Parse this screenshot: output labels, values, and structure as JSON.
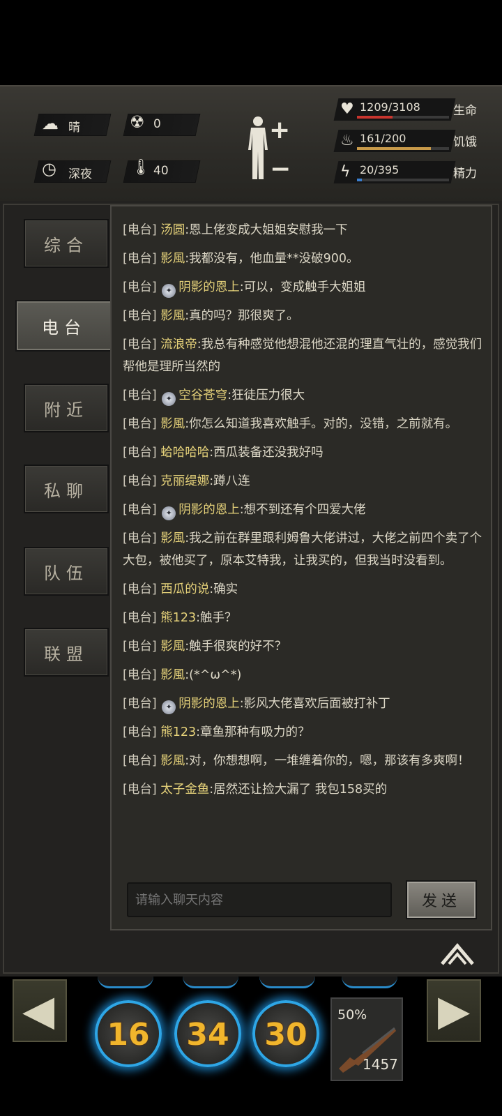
{
  "status": {
    "weather": "晴",
    "radiation": "0",
    "time_of_day": "深夜",
    "temperature": "40",
    "health": {
      "value": "1209/3108",
      "label": "生命",
      "fraction": 0.389,
      "color": "#c8352e"
    },
    "hunger": {
      "value": "161/200",
      "label": "饥饿",
      "fraction": 0.805,
      "color": "#c89a4a"
    },
    "energy": {
      "value": "20/395",
      "label": "精力",
      "fraction": 0.051,
      "color": "#3a7fd0"
    }
  },
  "tabs": [
    {
      "label": "综合"
    },
    {
      "label": "电台",
      "active": true
    },
    {
      "label": "附近"
    },
    {
      "label": "私聊"
    },
    {
      "label": "队伍"
    },
    {
      "label": "联盟"
    }
  ],
  "chat": {
    "messages": [
      {
        "channel": "[电台]",
        "name": "汤圆",
        "text": "恩上佬变成大姐姐安慰我一下",
        "badge": false
      },
      {
        "channel": "[电台]",
        "name": "影風",
        "text": "我都没有，他血量**没破900。",
        "badge": false
      },
      {
        "channel": "[电台]",
        "name": "阴影的恩上",
        "text": "可以，变成触手大姐姐",
        "badge": true
      },
      {
        "channel": "[电台]",
        "name": "影風",
        "text": "真的吗？那很爽了。",
        "badge": false
      },
      {
        "channel": "[电台]",
        "name": "流浪帝",
        "text": "我总有种感觉他想混他还混的理直气壮的，感觉我们帮他是理所当然的",
        "badge": false
      },
      {
        "channel": "[电台]",
        "name": "空谷苍穹",
        "text": "狂徒压力很大",
        "badge": true
      },
      {
        "channel": "[电台]",
        "name": "影風",
        "text": "你怎么知道我喜欢触手。对的，没错，之前就有。",
        "badge": false
      },
      {
        "channel": "[电台]",
        "name": "蛤哈哈哈",
        "text": "西瓜装备还没我好吗",
        "badge": false
      },
      {
        "channel": "[电台]",
        "name": "克丽缇娜",
        "text": "蹲八连",
        "badge": false
      },
      {
        "channel": "[电台]",
        "name": "阴影的恩上",
        "text": "想不到还有个四爱大佬",
        "badge": true
      },
      {
        "channel": "[电台]",
        "name": "影風",
        "text": "我之前在群里跟利姆鲁大佬讲过，大佬之前四个卖了个大包，被他买了，原本艾特我，让我买的，但我当时没看到。",
        "badge": false
      },
      {
        "channel": "[电台]",
        "name": "西瓜的说",
        "text": "确实",
        "badge": false
      },
      {
        "channel": "[电台]",
        "name": "熊123",
        "text": "触手？",
        "badge": false
      },
      {
        "channel": "[电台]",
        "name": "影風",
        "text": "触手很爽的好不？",
        "badge": false
      },
      {
        "channel": "[电台]",
        "name": "影風",
        "text": "(*^ω^*)",
        "badge": false
      },
      {
        "channel": "[电台]",
        "name": "阴影的恩上",
        "text": "影风大佬喜欢后面被打补丁",
        "badge": true
      },
      {
        "channel": "[电台]",
        "name": "熊123",
        "text": "章鱼那种有吸力的？",
        "badge": false
      },
      {
        "channel": "[电台]",
        "name": "影風",
        "text": "对，你想想啊，一堆缠着你的，嗯，那该有多爽啊！",
        "badge": false
      },
      {
        "channel": "[电台]",
        "name": "太子金鱼",
        "text": "居然还让捡大漏了 我包158买的",
        "badge": false
      }
    ],
    "input_placeholder": "请输入聊天内容",
    "send_label": "发送"
  },
  "hotbar": {
    "skills": [
      "16",
      "34",
      "30"
    ],
    "weapon_durability": "50%",
    "weapon_ammo": "1457"
  }
}
